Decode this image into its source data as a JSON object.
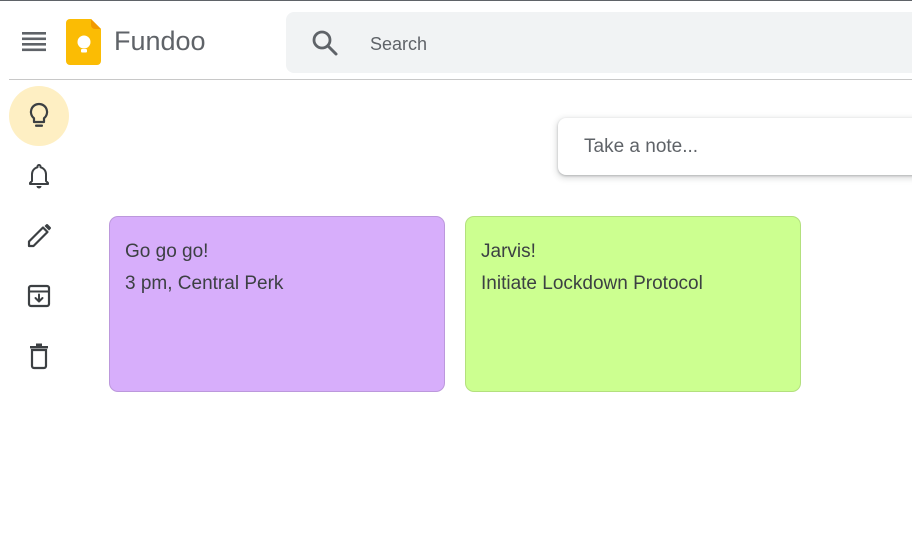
{
  "header": {
    "app_title": "Fundoo",
    "search_placeholder": "Search",
    "icons": {
      "menu": "menu-icon",
      "logo": "keep-logo-icon",
      "search": "search-icon"
    }
  },
  "sidebar": {
    "items": [
      {
        "name": "notes",
        "icon": "lightbulb-icon",
        "active": true
      },
      {
        "name": "reminders",
        "icon": "bell-icon",
        "active": false
      },
      {
        "name": "edit-labels",
        "icon": "pencil-icon",
        "active": false
      },
      {
        "name": "archive",
        "icon": "archive-icon",
        "active": false
      },
      {
        "name": "trash",
        "icon": "trash-icon",
        "active": false
      }
    ],
    "active_color": "#feefc3"
  },
  "composer": {
    "placeholder": "Take a note..."
  },
  "notes": [
    {
      "title": "Go go go!",
      "body": "3 pm, Central Perk",
      "color": "#d7aefb"
    },
    {
      "title": "Jarvis!",
      "body": "Initiate Lockdown Protocol",
      "color": "#ccff90"
    }
  ]
}
